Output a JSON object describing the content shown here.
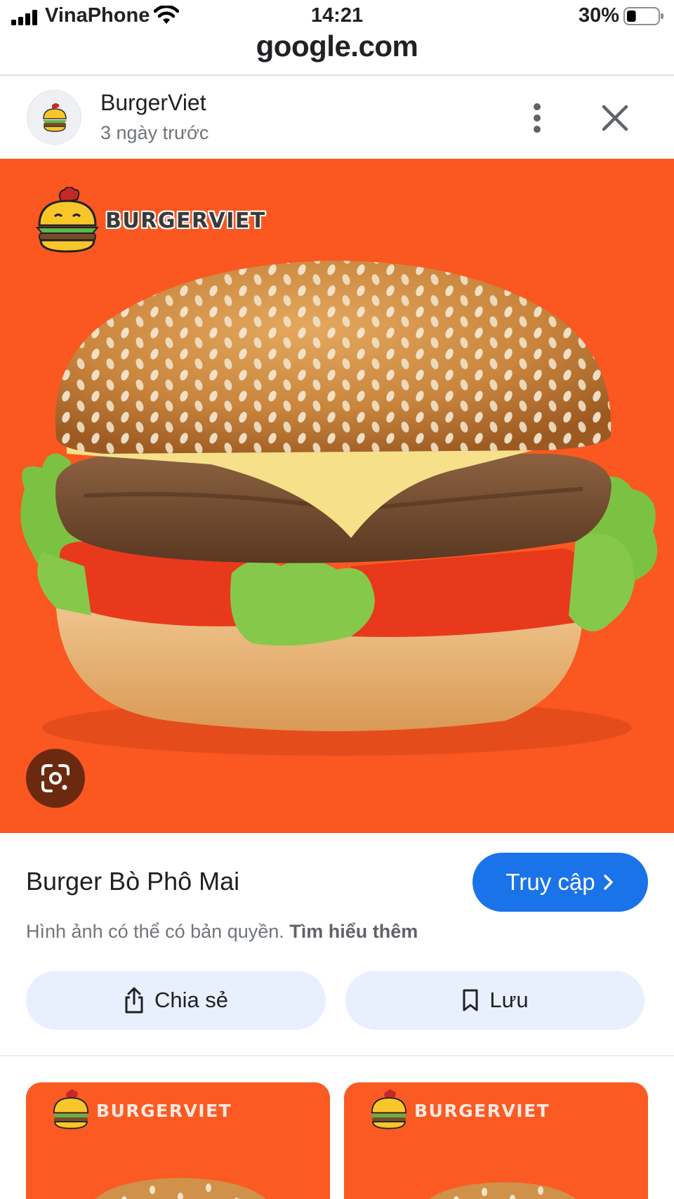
{
  "status_bar": {
    "carrier": "VinaPhone",
    "time": "14:21",
    "battery": "30%",
    "battery_level": 0.3
  },
  "browser": {
    "url": "google.com"
  },
  "source": {
    "name": "BurgerViet",
    "time_ago": "3 ngày trước"
  },
  "image": {
    "brand_text": "BURGERVIET"
  },
  "result": {
    "title": "Burger Bò Phô Mai",
    "visit_label": "Truy cập",
    "copyright_text": "Hình ảnh có thể có bản quyền.",
    "learn_more": "Tìm hiểu thêm"
  },
  "actions": {
    "share_label": "Chia sẻ",
    "save_label": "Lưu"
  },
  "related": [
    {
      "brand_text": "BURGERVIET"
    },
    {
      "brand_text": "BURGERVIET"
    }
  ],
  "icons": {
    "signal": "signal-icon",
    "wifi": "wifi-icon",
    "battery": "battery-icon",
    "more": "more-vert-icon",
    "close": "close-icon",
    "lens": "google-lens-icon",
    "share": "share-icon",
    "bookmark": "bookmark-icon",
    "chevron": "chevron-right-icon"
  },
  "colors": {
    "image_background": "#fb5720",
    "primary_button": "#1a73e8",
    "pill_button": "#e8f0fe"
  }
}
